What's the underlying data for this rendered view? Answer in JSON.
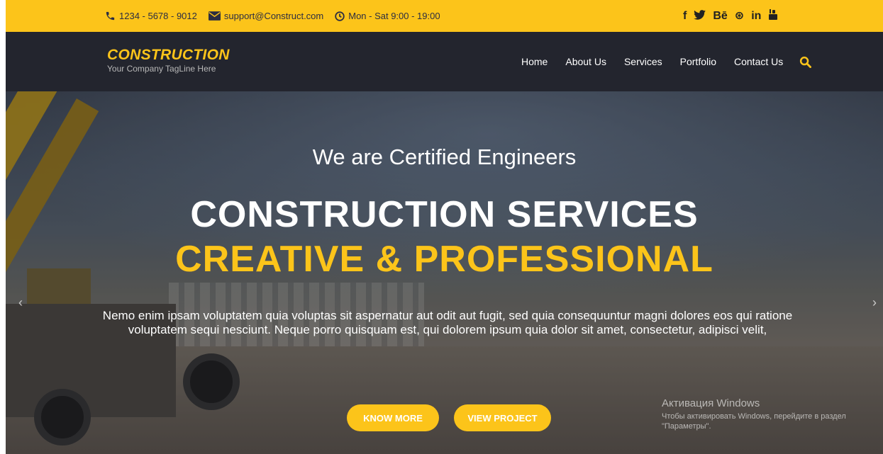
{
  "topbar": {
    "phone": "1234 - 5678 - 9012",
    "email": "support@Construct.com",
    "hours": "Mon - Sat 9:00 - 19:00",
    "social": [
      {
        "icon": "facebook-icon",
        "label": "f"
      },
      {
        "icon": "twitter-icon",
        "label": "🐦"
      },
      {
        "icon": "behance-icon",
        "label": "Bē"
      },
      {
        "icon": "dribbble-icon",
        "label": "⊛"
      },
      {
        "icon": "linkedin-icon",
        "label": "in"
      },
      {
        "icon": "youtube-icon",
        "label": "▣"
      }
    ]
  },
  "logo": {
    "name": "CONSTRUCTION",
    "tagline": "Your Company TagLine Here"
  },
  "nav": {
    "items": [
      "Home",
      "About Us",
      "Services",
      "Portfolio",
      "Contact Us"
    ]
  },
  "hero": {
    "subheading": "We are Certified Engineers",
    "heading1": "CONSTRUCTION SERVICES",
    "heading2": "CREATIVE & PROFESSIONAL",
    "description": "Nemo enim ipsam voluptatem quia voluptas sit aspernatur aut odit aut fugit, sed quia consequuntur magni dolores eos qui ratione voluptatem sequi nesciunt. Neque porro quisquam est, qui dolorem ipsum quia dolor sit amet, consectetur, adipisci velit,",
    "button_know": "KNOW MORE",
    "button_view": "VIEW PROJECT",
    "arrow_left": "‹",
    "arrow_right": "›"
  },
  "watermark": {
    "title": "Активация Windows",
    "text": "Чтобы активировать Windows, перейдите в раздел \"Параметры\"."
  },
  "colors": {
    "accent": "#fcc41a",
    "navbar": "#23252e"
  }
}
